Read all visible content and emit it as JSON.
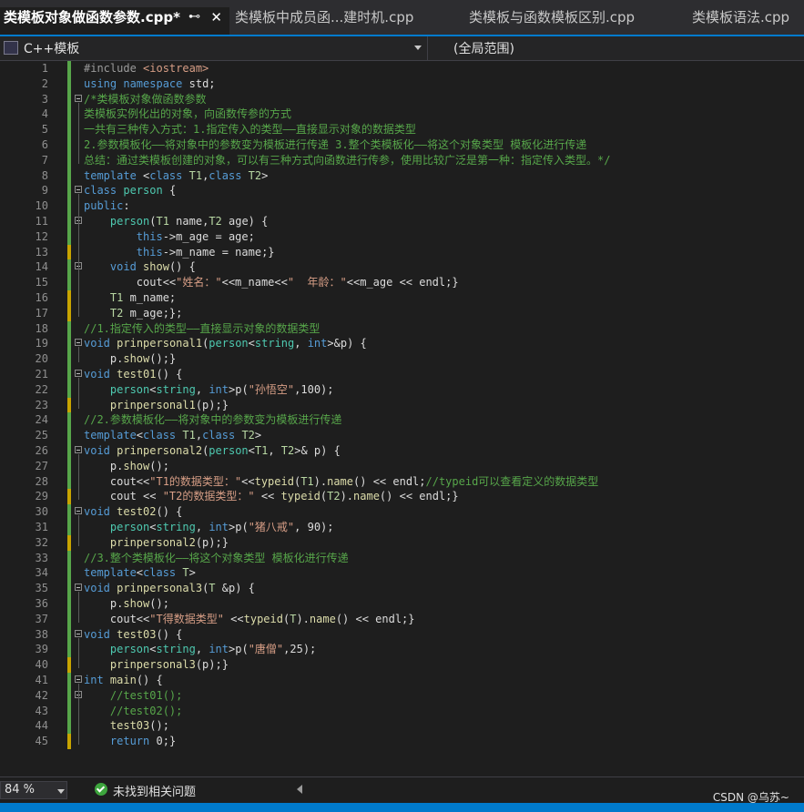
{
  "tabs": [
    {
      "label": "类模板对象做函数参数.cpp*",
      "active": true
    },
    {
      "label": "类模板中成员函...建时机.cpp",
      "active": false
    },
    {
      "label": "类模板与函数模板区别.cpp",
      "active": false
    },
    {
      "label": "类模板语法.cpp",
      "active": false
    }
  ],
  "tab_icons": {
    "pin": "pin-icon",
    "close": "close-icon"
  },
  "navbar": {
    "project": "C++模板",
    "scope": "(全局范围)"
  },
  "editor": {
    "lines": [
      "#include <iostream>",
      "using namespace std;",
      "/*类模板对象做函数参数",
      "类模板实例化出的对象，向函数传参的方式",
      "一共有三种传入方式：1.指定传入的类型——直接显示对象的数据类型",
      "2.参数模板化——将对象中的参数变为模板进行传递 3.整个类模板化——将这个对象类型 模板化进行传递",
      "总结：通过类模板创建的对象，可以有三种方式向函数进行传参，使用比较广泛是第一种：指定传入类型。*/",
      "template <class T1,class T2>",
      "class person {",
      "public:",
      "    person(T1 name,T2 age) {",
      "        this->m_age = age;",
      "        this->m_name = name;}",
      "    void show() {",
      "        cout<<\"姓名：\"<<m_name<<\"  年龄：\"<<m_age << endl;}",
      "    T1 m_name;",
      "    T2 m_age;};",
      "//1.指定传入的类型——直接显示对象的数据类型",
      "void prinpersonal1(person<string, int>&p) {",
      "    p.show();}",
      "void test01() {",
      "    person<string, int>p(\"孙悟空\",100);",
      "    prinpersonal1(p);}",
      "//2.参数模板化——将对象中的参数变为模板进行传递",
      "template<class T1,class T2>",
      "void prinpersonal2(person<T1, T2>& p) {",
      "    p.show();",
      "    cout<<\"T1的数据类型：\"<<typeid(T1).name() << endl;//typeid可以查看定义的数据类型",
      "    cout << \"T2的数据类型：\" << typeid(T2).name() << endl;}",
      "void test02() {",
      "    person<string, int>p(\"猪八戒\", 90);",
      "    prinpersonal2(p);}",
      "//3.整个类模板化——将这个对象类型 模板化进行传递",
      "template<class T>",
      "void prinpersonal3(T &p) {",
      "    p.show();",
      "    cout<<\"T得数据类型\" <<typeid(T).name() << endl;}",
      "void test03() {",
      "    person<string, int>p(\"唐僧\",25);",
      "    prinpersonal3(p);}",
      "int main() {",
      "    //test01();",
      "    //test02();",
      "    test03();",
      "    return 0;}"
    ],
    "change_colors": {
      "saved": "#57a64a",
      "unsaved": "#c8a400"
    },
    "unsaved_lines": [
      13,
      16,
      17,
      23,
      29,
      32,
      40,
      45
    ]
  },
  "statusbar": {
    "zoom": "84 %",
    "issues": "未找到相关问题",
    "watermark": "CSDN @乌苏~"
  },
  "colors": {
    "accent": "#007acc",
    "background": "#1e1e1e",
    "keyword": "#569cd6",
    "comment": "#57a64a",
    "string": "#d69d85",
    "type": "#4ec9b0"
  }
}
